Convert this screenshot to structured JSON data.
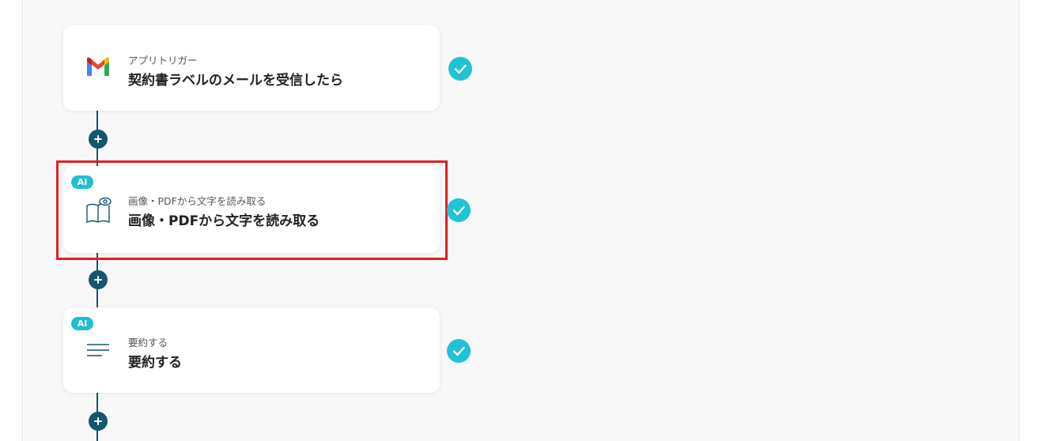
{
  "flow": {
    "steps": [
      {
        "subtitle": "アプリトリガー",
        "title": "契約書ラベルのメールを受信したら",
        "icon": "gmail-icon",
        "ai": false
      },
      {
        "subtitle": "画像・PDFから文字を読み取る",
        "title": "画像・PDFから文字を読み取る",
        "icon": "book-eye-icon",
        "ai": true,
        "badge": "AI"
      },
      {
        "subtitle": "要約する",
        "title": "要約する",
        "icon": "summary-lines-icon",
        "ai": true,
        "badge": "AI"
      }
    ]
  },
  "colors": {
    "connector": "#15556e",
    "check": "#1fc3d4",
    "ai_badge": "#1fbfd1",
    "highlight": "#e11f24"
  }
}
